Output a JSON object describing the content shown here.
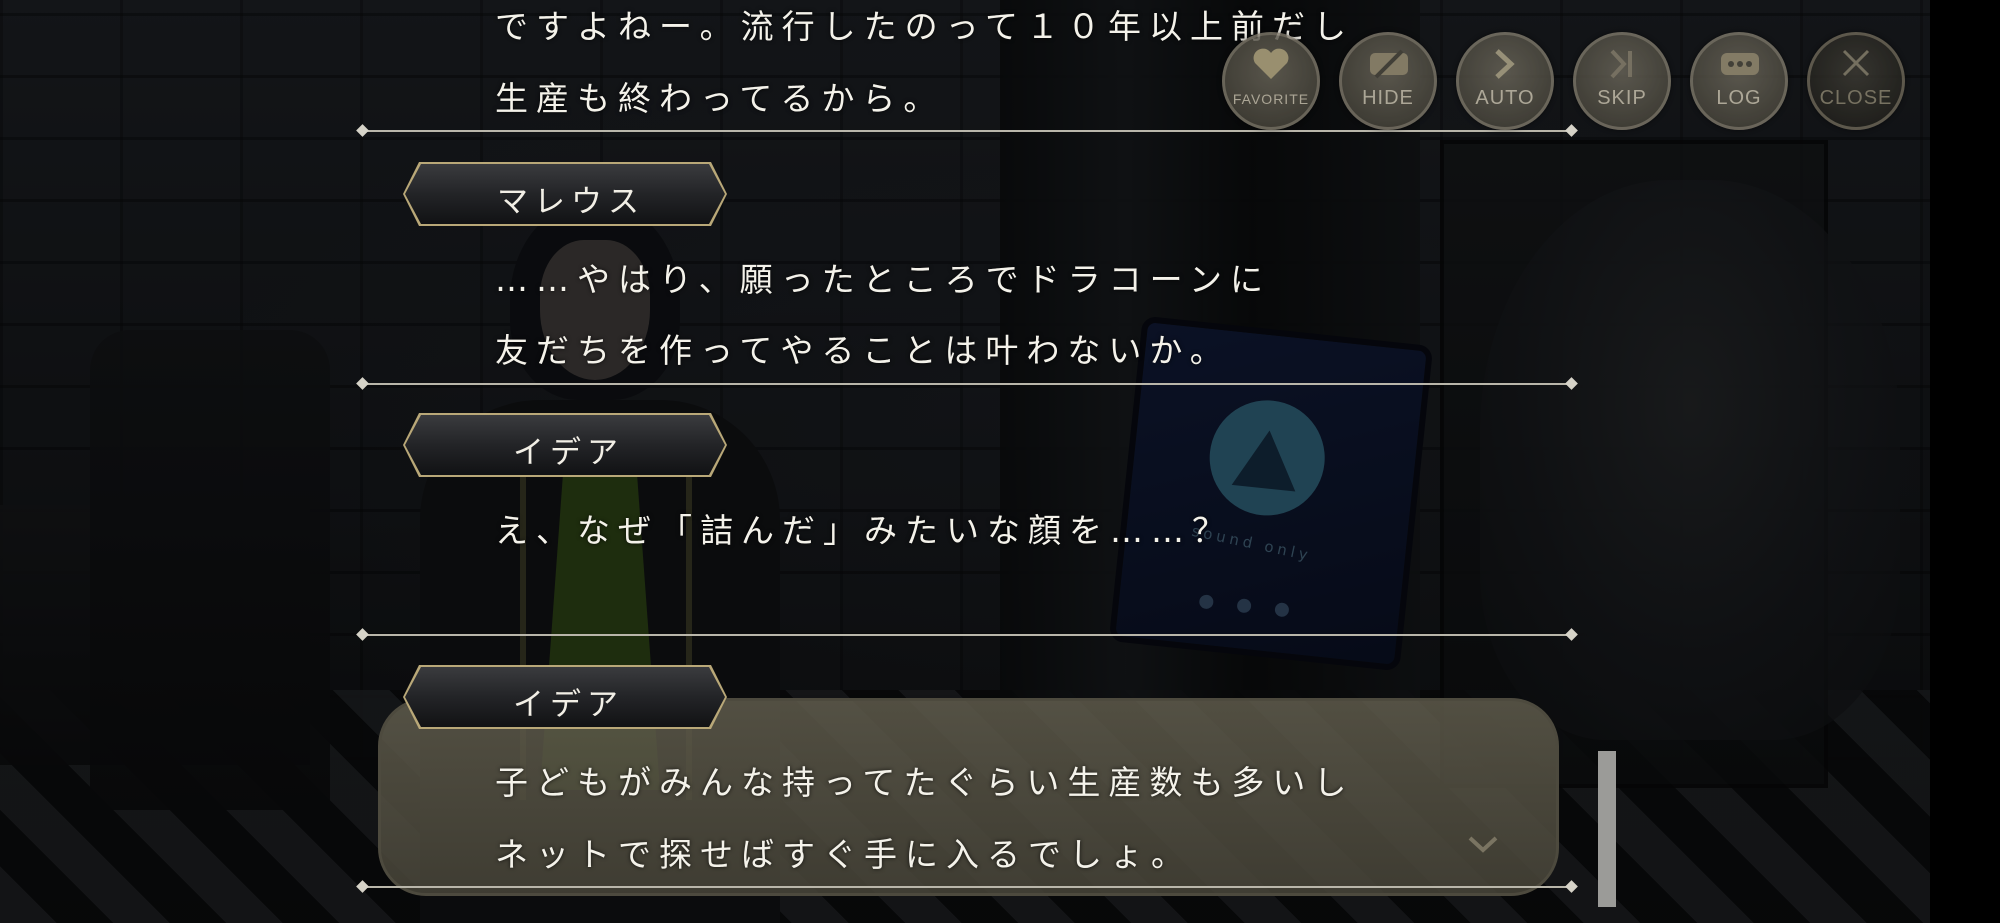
{
  "controls": {
    "favorite": "FAVORITE",
    "hide": "HIDE",
    "auto": "AUTO",
    "skip": "SKIP",
    "log": "LOG",
    "close": "CLOSE"
  },
  "background": {
    "tablet_text": "sound only"
  },
  "log_entries": [
    {
      "speaker": "",
      "lines": [
        "ですよねー。流行したのって１０年以上前だし",
        "生産も終わってるから。"
      ]
    },
    {
      "speaker": "マレウス",
      "lines": [
        "……やはり、願ったところでドラコーンに",
        "友だちを作ってやることは叶わないか。"
      ]
    },
    {
      "speaker": "イデア",
      "lines": [
        "え、なぜ「詰んだ」みたいな顔を……？"
      ]
    },
    {
      "speaker": "イデア",
      "lines": [
        "子どもがみんな持ってたぐらい生産数も多いし",
        "ネットで探せばすぐ手に入るでしょ。"
      ]
    }
  ],
  "colors": {
    "text": "#f4f2ea",
    "nameplate_border": "#b9a878",
    "separator": "#b9b6aa",
    "current_box": "#625e4e"
  }
}
